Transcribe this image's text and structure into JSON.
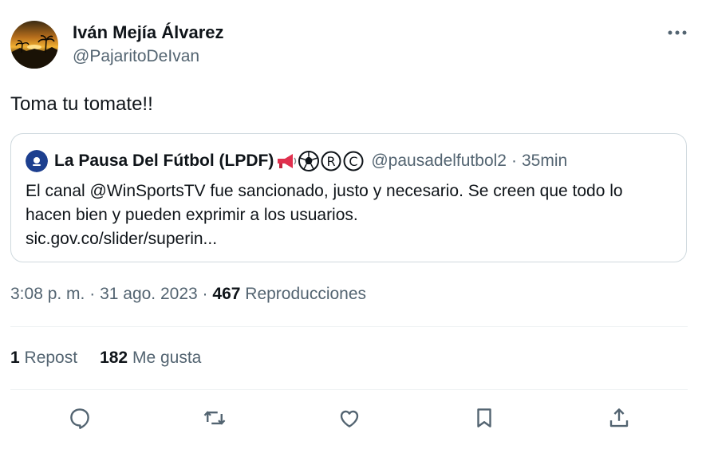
{
  "author": {
    "name": "Iván Mejía Álvarez",
    "handle": "@PajaritoDeIvan",
    "avatar_icon": "sunset-avatar"
  },
  "tweet": {
    "text": "Toma tu tomate!!"
  },
  "quote": {
    "name": "La Pausa Del Fútbol (LPDF)",
    "emoji_icons": [
      "megaphone-icon",
      "soccer-ball-icon",
      "registered-icon",
      "copyright-icon"
    ],
    "handle": "@pausadelfutbol2",
    "separator": "·",
    "time": "35min",
    "body_lines": [
      "El canal @WinSportsTV fue sancionado, justo y necesario. Se creen que todo lo",
      "hacen bien y pueden exprimir a los usuarios.",
      "sic.gov.co/slider/superin..."
    ]
  },
  "meta": {
    "time": "3:08 p. m.",
    "sep1": "·",
    "date": "31 ago. 2023",
    "sep2": "·",
    "views_count": "467",
    "views_label": "Reproducciones"
  },
  "stats": {
    "reposts_count": "1",
    "reposts_label": "Repost",
    "likes_count": "182",
    "likes_label": "Me gusta"
  },
  "actions": [
    "reply-icon",
    "repost-icon",
    "like-icon",
    "bookmark-icon",
    "share-icon"
  ],
  "colors": {
    "text": "#0f1419",
    "secondary": "#536471",
    "border": "#cfd9de",
    "divider": "#eff3f4"
  }
}
